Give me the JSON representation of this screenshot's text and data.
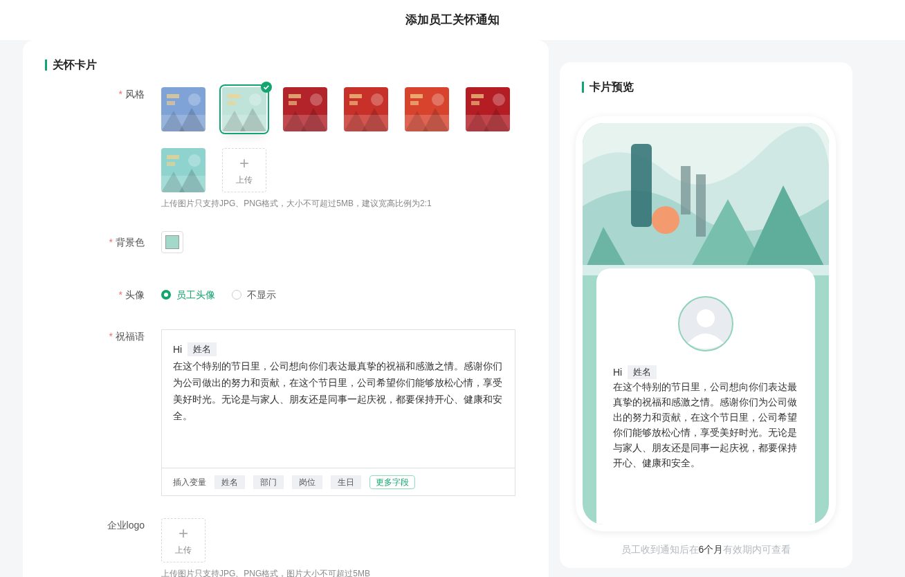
{
  "header": {
    "title": "添加员工关怀通知"
  },
  "form": {
    "section_title": "关怀卡片",
    "style": {
      "label": "风格",
      "required_mark": "*",
      "items": [
        {
          "kind": "picture",
          "color": "#7fa3d6",
          "selected": false
        },
        {
          "kind": "picture",
          "color": "#bfe3d8",
          "selected": true
        },
        {
          "kind": "picture",
          "color": "#b3232a",
          "selected": false
        },
        {
          "kind": "picture",
          "color": "#c8302a",
          "selected": false
        },
        {
          "kind": "picture",
          "color": "#d8432e",
          "selected": false
        },
        {
          "kind": "picture",
          "color": "#b51d24",
          "selected": false
        },
        {
          "kind": "picture",
          "color": "#8fd3cf",
          "selected": false
        }
      ],
      "upload": {
        "icon": "+",
        "label": "上传"
      },
      "hint": "上传图片只支持JPG、PNG格式，大小不可超过5MB，建议宽高比例为2:1"
    },
    "background": {
      "label": "背景色",
      "required_mark": "*",
      "color": "#a3d9c9"
    },
    "avatar": {
      "label": "头像",
      "required_mark": "*",
      "options": [
        {
          "label": "员工头像",
          "selected": true
        },
        {
          "label": "不显示",
          "selected": false
        }
      ]
    },
    "greeting": {
      "label": "祝福语",
      "required_mark": "*",
      "hi": "Hi",
      "name_tag": "姓名",
      "body": "在这个特别的节日里，公司想向你们表达最真挚的祝福和感激之情。感谢你们为公司做出的努力和贡献，在这个节日里，公司希望你们能够放松心情，享受美好时光。无论是与家人、朋友还是同事一起庆祝，都要保持开心、健康和安全。",
      "insert_label": "插入变量",
      "variables": [
        "姓名",
        "部门",
        "岗位",
        "生日"
      ],
      "more": "更多字段"
    },
    "logo": {
      "label": "企业logo",
      "upload": {
        "icon": "+",
        "label": "上传"
      },
      "hint": "上传图片只支持JPG、PNG格式，图片大小不可超过5MB"
    }
  },
  "preview": {
    "title": "卡片预览",
    "hi": "Hi",
    "name_tag": "姓名",
    "body": "在这个特别的节日里，公司想向你们表达最真挚的祝福和感激之情。感谢你们为公司做出的努力和贡献，在这个节日里，公司希望你们能够放松心情，享受美好时光。无论是与家人、朋友还是同事一起庆祝，都要保持开心、健康和安全。",
    "footer": {
      "before": "员工收到通知后在",
      "highlight": "6个月",
      "after": "有效期内可查看"
    }
  }
}
